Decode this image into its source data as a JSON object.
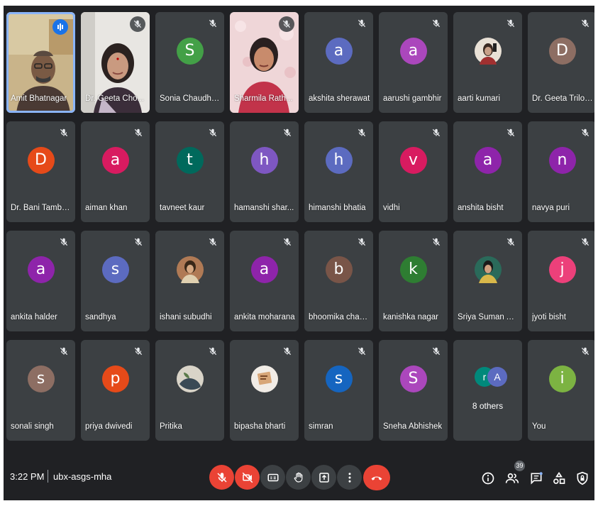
{
  "tiles": [
    {
      "name": "Amit Bhatnagar",
      "kind": "photo",
      "photo": "man-glasses"
    },
    {
      "name": "Dr. Geeta Cho...",
      "kind": "photo",
      "photo": "woman-bindi"
    },
    {
      "name": "Sonia Chaudhary",
      "kind": "letter",
      "initial": "S",
      "color": "#43a047"
    },
    {
      "name": "Sharmila Rath...",
      "kind": "photo",
      "photo": "woman-pink"
    },
    {
      "name": "akshita sherawat",
      "kind": "letter",
      "initial": "a",
      "color": "#5c6bc0"
    },
    {
      "name": "aarushi gambhir",
      "kind": "letter",
      "initial": "a",
      "color": "#ab47bc"
    },
    {
      "name": "aarti kumari",
      "kind": "pic",
      "photo": "selfie"
    },
    {
      "name": "Dr. Geeta Trilok...",
      "kind": "letter",
      "initial": "D",
      "color": "#8d6e63"
    },
    {
      "name": "Dr. Bani Tamber...",
      "kind": "letter",
      "initial": "D",
      "color": "#e64a19"
    },
    {
      "name": "aiman khan",
      "kind": "letter",
      "initial": "a",
      "color": "#d81b60"
    },
    {
      "name": "tavneet kaur",
      "kind": "letter",
      "initial": "t",
      "color": "#00695c"
    },
    {
      "name": "hamanshi shar...",
      "kind": "letter",
      "initial": "h",
      "color": "#7e57c2"
    },
    {
      "name": "himanshi bhatia",
      "kind": "letter",
      "initial": "h",
      "color": "#5c6bc0"
    },
    {
      "name": "vidhi",
      "kind": "letter",
      "initial": "v",
      "color": "#d81b60"
    },
    {
      "name": "anshita bisht",
      "kind": "letter",
      "initial": "a",
      "color": "#8e24aa"
    },
    {
      "name": "navya puri",
      "kind": "letter",
      "initial": "n",
      "color": "#8e24aa"
    },
    {
      "name": "ankita halder",
      "kind": "letter",
      "initial": "a",
      "color": "#8e24aa"
    },
    {
      "name": "sandhya",
      "kind": "letter",
      "initial": "s",
      "color": "#5c6bc0"
    },
    {
      "name": "ishani subudhi",
      "kind": "pic",
      "photo": "selfie2"
    },
    {
      "name": "ankita moharana",
      "kind": "letter",
      "initial": "a",
      "color": "#8e24aa"
    },
    {
      "name": "bhoomika chad...",
      "kind": "letter",
      "initial": "b",
      "color": "#795548"
    },
    {
      "name": "kanishka nagar",
      "kind": "letter",
      "initial": "k",
      "color": "#2e7d32"
    },
    {
      "name": "Sriya Suman Ac...",
      "kind": "pic",
      "photo": "selfie3"
    },
    {
      "name": "jyoti bisht",
      "kind": "letter",
      "initial": "j",
      "color": "#ec407a"
    },
    {
      "name": "sonali singh",
      "kind": "letter",
      "initial": "s",
      "color": "#8d6e63"
    },
    {
      "name": "priya dwivedi",
      "kind": "letter",
      "initial": "p",
      "color": "#e64a19"
    },
    {
      "name": "Pritika",
      "kind": "pic",
      "photo": "nature"
    },
    {
      "name": "bipasha bharti",
      "kind": "pic",
      "photo": "card"
    },
    {
      "name": "simran",
      "kind": "letter",
      "initial": "s",
      "color": "#1565c0"
    },
    {
      "name": "Sneha Abhishek",
      "kind": "letter",
      "initial": "S",
      "color": "#ab47bc"
    },
    {
      "name": "",
      "kind": "others",
      "others_label": "8 others",
      "avatars": [
        {
          "initial": "r",
          "color": "#00897b"
        },
        {
          "initial": "A",
          "color": "#5c6bc0"
        }
      ]
    },
    {
      "name": "You",
      "kind": "letter",
      "initial": "i",
      "color": "#7cb342"
    }
  ],
  "bottom_bar": {
    "time": "3:22 PM",
    "meeting_code": "ubx-asgs-mha",
    "participant_count": "39"
  },
  "colors": {
    "background": "#202124",
    "tile": "#3c4043",
    "danger": "#ea4335",
    "accent": "#1a73e8"
  },
  "icons": [
    "mic-off-icon",
    "camera-off-icon",
    "captions-icon",
    "raise-hand-icon",
    "present-icon",
    "more-options-icon",
    "hang-up-icon",
    "info-icon",
    "people-icon",
    "chat-icon",
    "activities-icon",
    "host-controls-icon"
  ]
}
